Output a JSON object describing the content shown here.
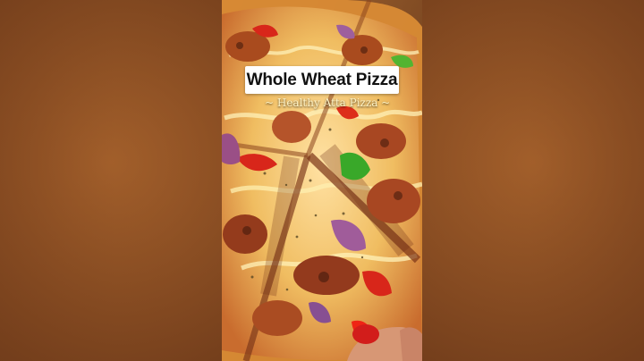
{
  "image": {
    "title": "Whole Wheat Pizza",
    "subtitle": "~ Healthy Atta Pizza ~",
    "subject": "pizza-photo"
  },
  "colors": {
    "background_brown": "#8b4f25",
    "cheese": "#f0c46b",
    "crust": "#c8782d",
    "red_pepper": "#d8261a",
    "green_pepper": "#39a829",
    "onion": "#9a4f86"
  }
}
